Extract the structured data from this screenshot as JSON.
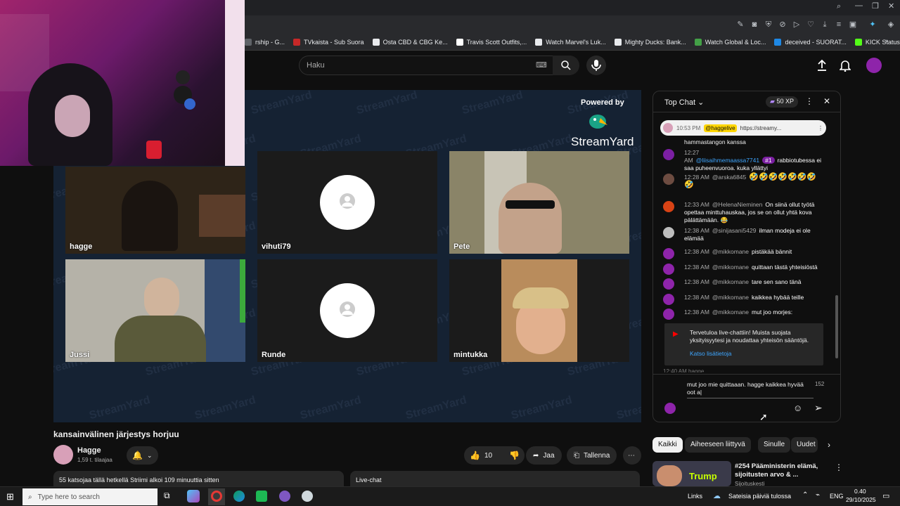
{
  "browser": {
    "bookmarks": [
      {
        "label": "rship - G...",
        "color": "#5f6368"
      },
      {
        "label": "TVkaista - Sub Suora",
        "color": "#c62828"
      },
      {
        "label": "Osta CBD & CBG Ke...",
        "color": "#e8eaed"
      },
      {
        "label": "Travis Scott Outfits,...",
        "color": "#ffffff"
      },
      {
        "label": "Watch Marvel's Luk...",
        "color": "#e8eaed"
      },
      {
        "label": "Mighty Ducks: Bank...",
        "color": "#e8eaed"
      },
      {
        "label": "Watch Global & Loc...",
        "color": "#43a047"
      },
      {
        "label": "deceived - SUORAT...",
        "color": "#1e88e5"
      },
      {
        "label": "KICK Status Page",
        "color": "#53fc18"
      }
    ]
  },
  "yt": {
    "search_placeholder": "Haku"
  },
  "stage": {
    "powered_by": "Powered by",
    "brand": "StreamYard",
    "watermark": "StreamYard",
    "participants": [
      {
        "name": "hagge"
      },
      {
        "name": "vihuti79"
      },
      {
        "name": "Pete"
      },
      {
        "name": "Jussi"
      },
      {
        "name": "Runde"
      },
      {
        "name": "mintukka"
      }
    ]
  },
  "video": {
    "title": "kansainvälinen järjestys horjuu",
    "channel": "Hagge",
    "subs": "1,59 t. tilaajaa",
    "likes": "10",
    "share": "Jaa",
    "save": "Tallenna",
    "desc": "55 katsojaa tällä hetkellä  Striimi alkoi 109 minuuttia sitten",
    "livechat_label": "Live-chat"
  },
  "chat": {
    "header": "Top Chat",
    "xp": "50 XP",
    "pinned": {
      "time": "10:53 PM",
      "author": "@haggelive",
      "text": "https://streamy..."
    },
    "top_line": "hammastangon kanssa",
    "messages": [
      {
        "time": "12:27 AM",
        "author": "@liisaihmemaassa7741",
        "badge": "#1",
        "text": "rabbiotubessa ei saa puheenvuoroa. kuka yllättyi",
        "color": "#7b1fa2"
      },
      {
        "time": "12:28 AM",
        "author": "@arska6845",
        "text": "🤣🤣🤣🤣🤣🤣🤣🤣",
        "color": "#6d4c41"
      },
      {
        "time": "12:33 AM",
        "author": "@HelenaNieminen",
        "text": "On siinä ollut työtä opettaa minttuhauskaa, jos se on ollut yhtä kova pälättämään. 😂",
        "color": "#d84315"
      },
      {
        "time": "12:38 AM",
        "author": "@sinijasani5429",
        "text": "ilman modeja ei ole elämää",
        "color": "#bdbdbd"
      },
      {
        "time": "12:38 AM",
        "author": "@mikkomane",
        "text": "pistäkää bännit",
        "color": "#8e24aa"
      },
      {
        "time": "12:38 AM",
        "author": "@mikkomane",
        "text": "quittaan tästä yhteisiöstä",
        "color": "#8e24aa"
      },
      {
        "time": "12:38 AM",
        "author": "@mikkomane",
        "text": "tare sen sano tänä",
        "color": "#8e24aa"
      },
      {
        "time": "12:38 AM",
        "author": "@mikkomane",
        "text": "kaikkea hybää teille",
        "color": "#8e24aa"
      },
      {
        "time": "12:38 AM",
        "author": "@mikkomane",
        "text": "mut joo morjes:",
        "color": "#8e24aa"
      }
    ],
    "welcome": "Tervetuloa live-chattiin! Muista suojata yksityisyytesi ja noudattaa yhteisön sääntöjä.",
    "learn_more": "Katso lisätietoja",
    "cut_line": "12:40 AM  hagge  ...",
    "input_value": "mut joo mie quittaaan. hagge kaikkea hyvää oot a|",
    "char_count": "152"
  },
  "recs": {
    "chips": [
      "Kaikki",
      "Aiheeseen liittyvä",
      "Sinulle",
      "Uudet"
    ],
    "item_title": "#254 Pääministerin elämä, sijoitusten arvo & ...",
    "item_channel": "Sijoituskesti",
    "thumb_label": "Trump"
  },
  "taskbar": {
    "search_placeholder": "Type here to search",
    "links": "Links",
    "weather": "Sateisia päiviä tulossa",
    "lang": "ENG",
    "time": "0.40",
    "date": "29/10/2025"
  }
}
